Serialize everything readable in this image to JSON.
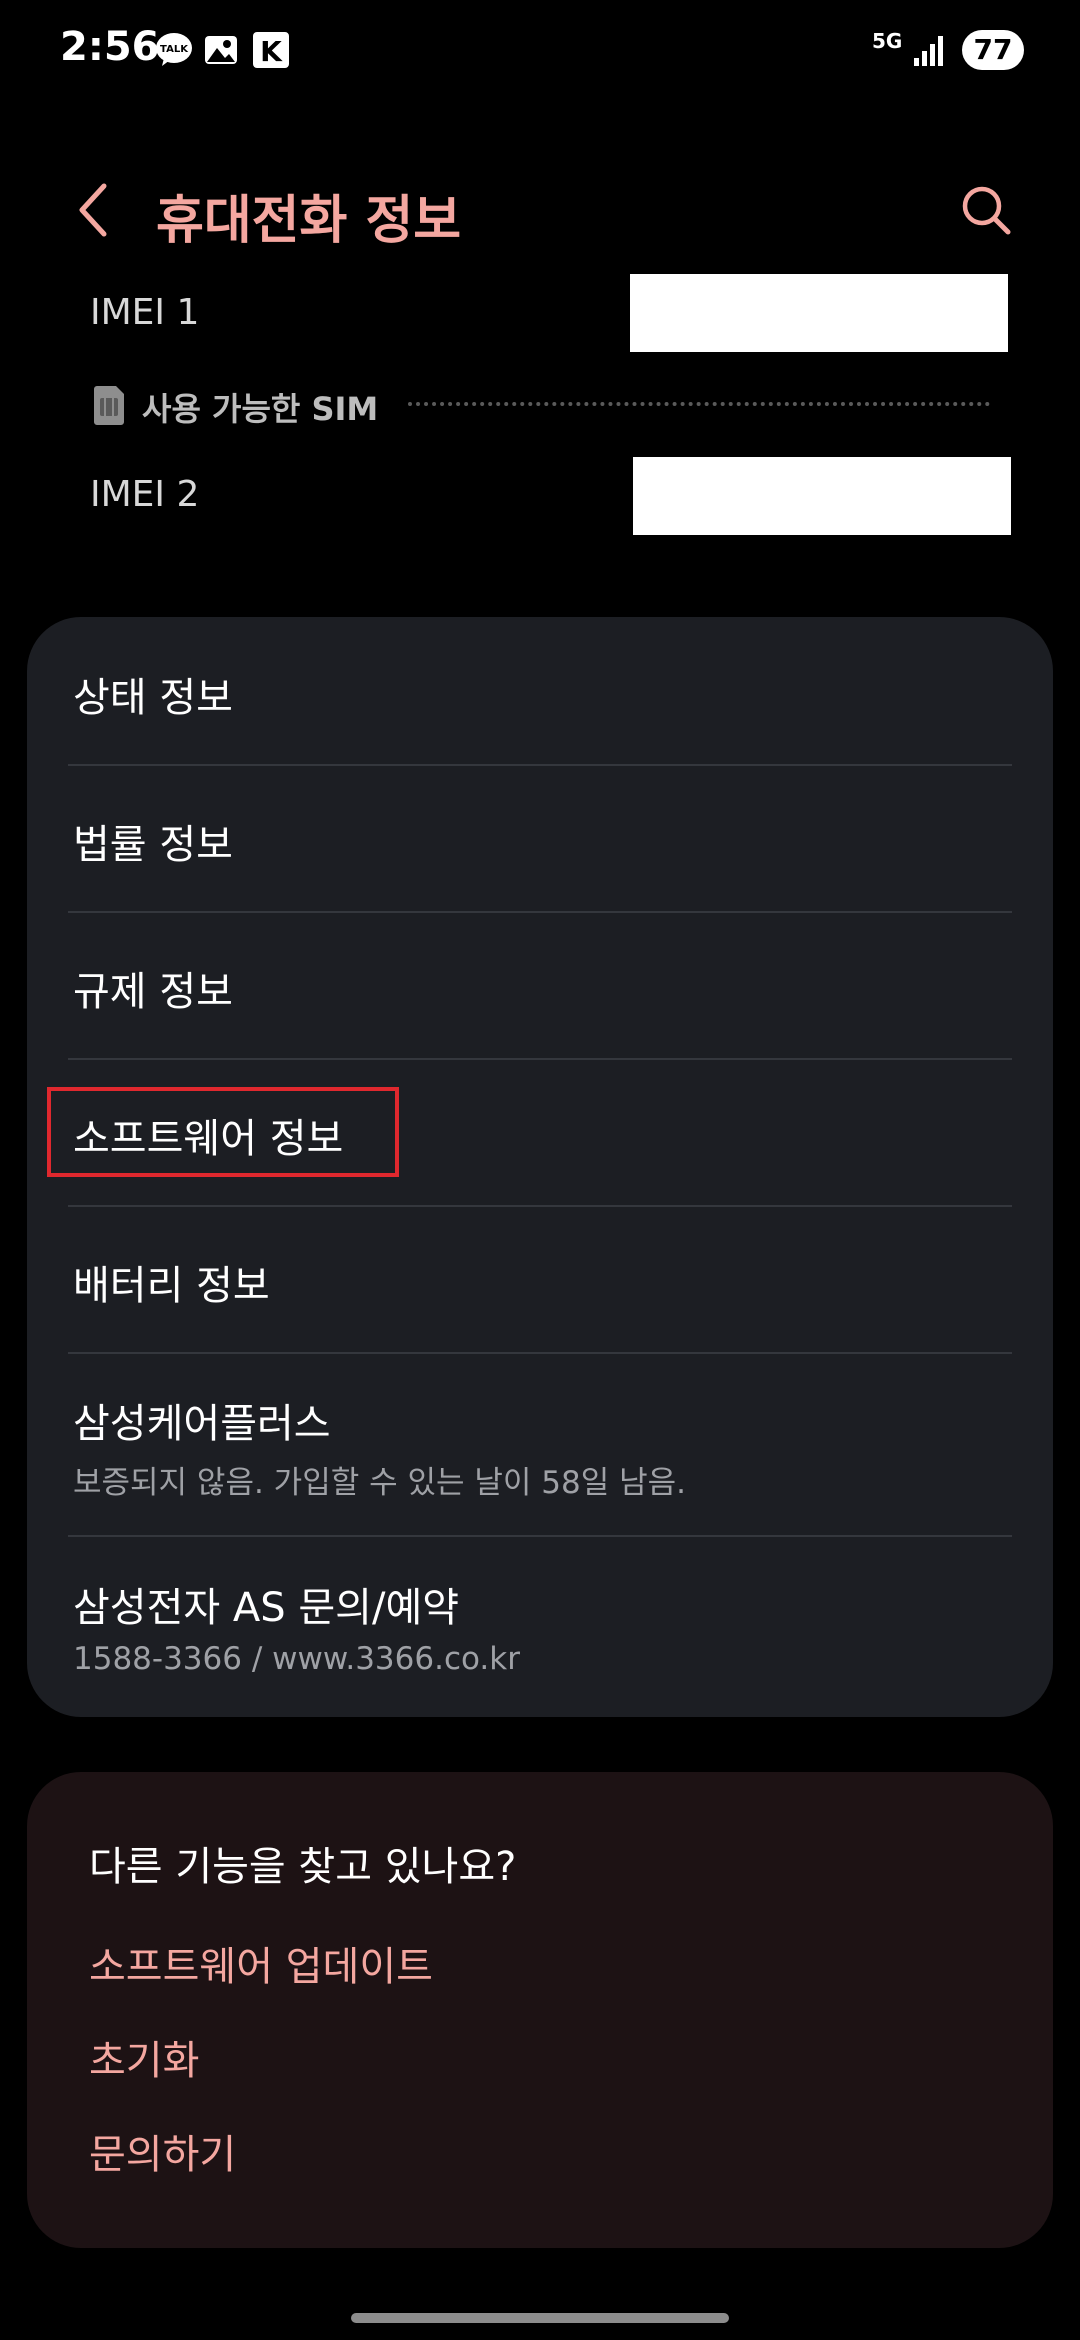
{
  "status_bar": {
    "time": "2:56",
    "network": "5G",
    "battery": "77",
    "icons": [
      "kakaotalk-icon",
      "gallery-icon",
      "k-app-icon",
      "signal-icon"
    ]
  },
  "header": {
    "title": "휴대전화 정보",
    "back_icon": "chevron-left-icon",
    "search_icon": "search-icon"
  },
  "imei": {
    "imei1_label": "IMEI 1",
    "imei2_label": "IMEI 2",
    "sim_label": "사용 가능한 SIM"
  },
  "menu": {
    "items": [
      {
        "label": "상태 정보"
      },
      {
        "label": "법률 정보"
      },
      {
        "label": "규제 정보"
      },
      {
        "label": "소프트웨어 정보"
      },
      {
        "label": "배터리 정보"
      },
      {
        "label": "삼성케어플러스",
        "sub": "보증되지 않음. 가입할 수 있는 날이 58일 남음."
      },
      {
        "label": "삼성전자 AS 문의/예약",
        "sub": "1588-3366 / www.3366.co.kr"
      }
    ]
  },
  "related": {
    "title": "다른 기능을 찾고 있나요?",
    "links": [
      "소프트웨어 업데이트",
      "초기화",
      "문의하기"
    ]
  },
  "colors": {
    "accent": "#f4a7a0",
    "card_bg": "#1c1e23",
    "related_bg": "#1d1214",
    "highlight": "#e0282e"
  }
}
